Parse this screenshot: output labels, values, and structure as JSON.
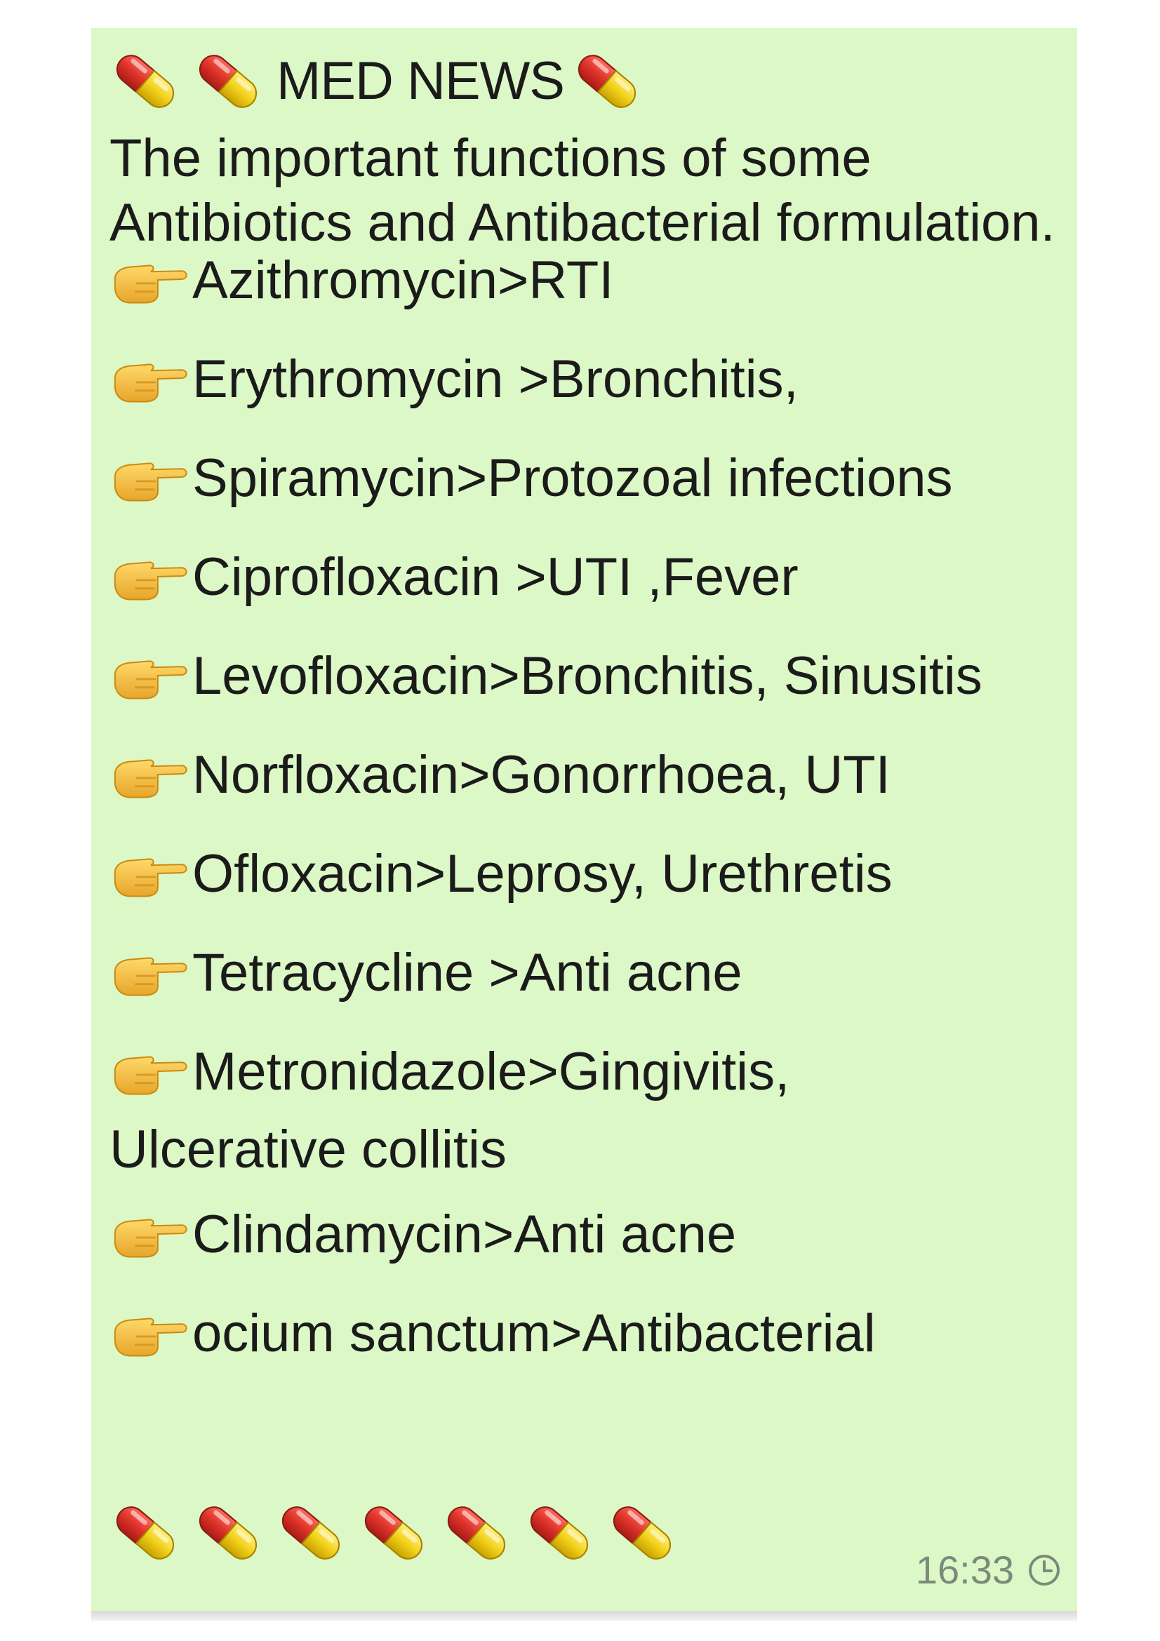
{
  "header": {
    "title": "MED NEWS",
    "icon": "pill-capsule-icon"
  },
  "intro": "The important functions of some Antibiotics and Antibacterial formulation.",
  "list_icon": "pointing-hand-icon",
  "items": [
    {
      "line1": "Azithromycin>RTI"
    },
    {
      "line1": "Erythromycin >Bronchitis,"
    },
    {
      "line1": "Spiramycin>Protozoal infections"
    },
    {
      "line1": "Ciprofloxacin >UTI ,Fever"
    },
    {
      "line1": "Levofloxacin>Bronchitis, Sinusitis"
    },
    {
      "line1": "Norfloxacin>Gonorrhoea, UTI"
    },
    {
      "line1": "Ofloxacin>Leprosy, Urethretis"
    },
    {
      "line1": "Tetracycline >Anti acne"
    },
    {
      "line1": "Metronidazole>Gingivitis,",
      "line2": "Ulcerative collitis"
    },
    {
      "line1": "Clindamycin>Anti acne"
    },
    {
      "line1": "ocium sanctum>Antibacterial"
    }
  ],
  "footer": {
    "time": "16:33",
    "status_icon": "clock-pending-icon"
  },
  "colors": {
    "bubble": "#dcf8c6",
    "pill_red": "#e0342b",
    "pill_yellow": "#f2d21b",
    "hand": "#f6c24a"
  }
}
